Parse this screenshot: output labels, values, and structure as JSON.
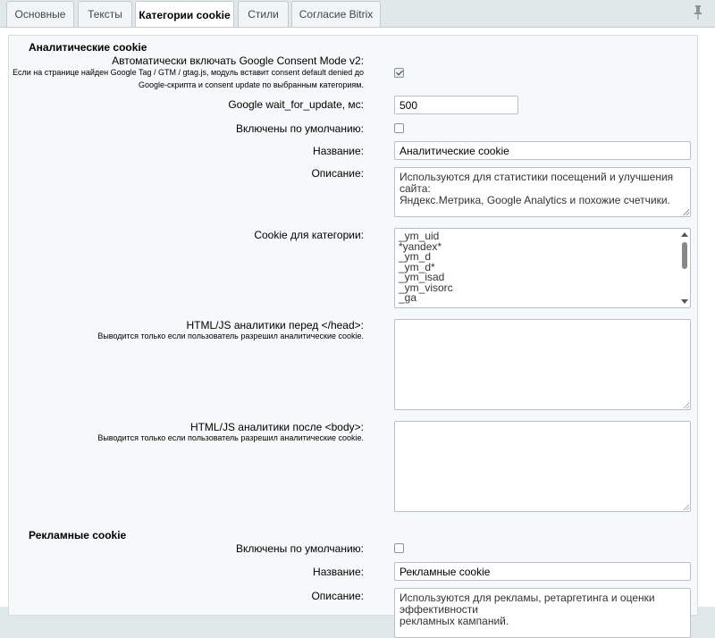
{
  "tabs": [
    {
      "label": "Основные",
      "active": false
    },
    {
      "label": "Тексты",
      "active": false
    },
    {
      "label": "Категории cookie",
      "active": true
    },
    {
      "label": "Стили",
      "active": false
    },
    {
      "label": "Согласие Bitrix",
      "active": false
    }
  ],
  "pin_icon": "pin-icon",
  "analytics": {
    "section_title": "Аналитические cookie",
    "consent_mode_label": "Автоматически включать Google Consent Mode v2:",
    "consent_mode_hint_line1": "Если на странице найден Google Tag / GTM / gtag.js, модуль вставит consent default denied до",
    "consent_mode_hint_line2": "Google-скрипта и consent update по выбранным категориям.",
    "consent_mode_checked": true,
    "wait_label": "Google wait_for_update, мс:",
    "wait_value": "500",
    "default_label": "Включены по умолчанию:",
    "default_checked": false,
    "name_label": "Название:",
    "name_value": "Аналитические cookie",
    "desc_label": "Описание:",
    "desc_line1": "Используются для статистики посещений и улучшения сайта:",
    "desc_line2": "Яндекс.Метрика, Google Analytics и похожие счетчики.",
    "cookies_label": "Cookie для категории:",
    "cookies": [
      "_ym_uid",
      "*yandex*",
      "_ym_d",
      "_ym_d*",
      "_ym_isad",
      "_ym_visorc",
      "_ga"
    ],
    "head_label": "HTML/JS аналитики перед </head>:",
    "head_hint": "Выводится только если пользователь разрешил аналитические cookie.",
    "body_label": "HTML/JS аналитики после <body>:",
    "body_hint": "Выводится только если пользователь разрешил аналитические cookie."
  },
  "marketing": {
    "section_title": "Рекламные cookie",
    "default_label": "Включены по умолчанию:",
    "default_checked": false,
    "name_label": "Название:",
    "name_value": "Рекламные cookie",
    "desc_label": "Описание:",
    "desc_line1": "Используются для рекламы, ретаргетинга и оценки эффективности",
    "desc_line2": "рекламных кампаний."
  }
}
